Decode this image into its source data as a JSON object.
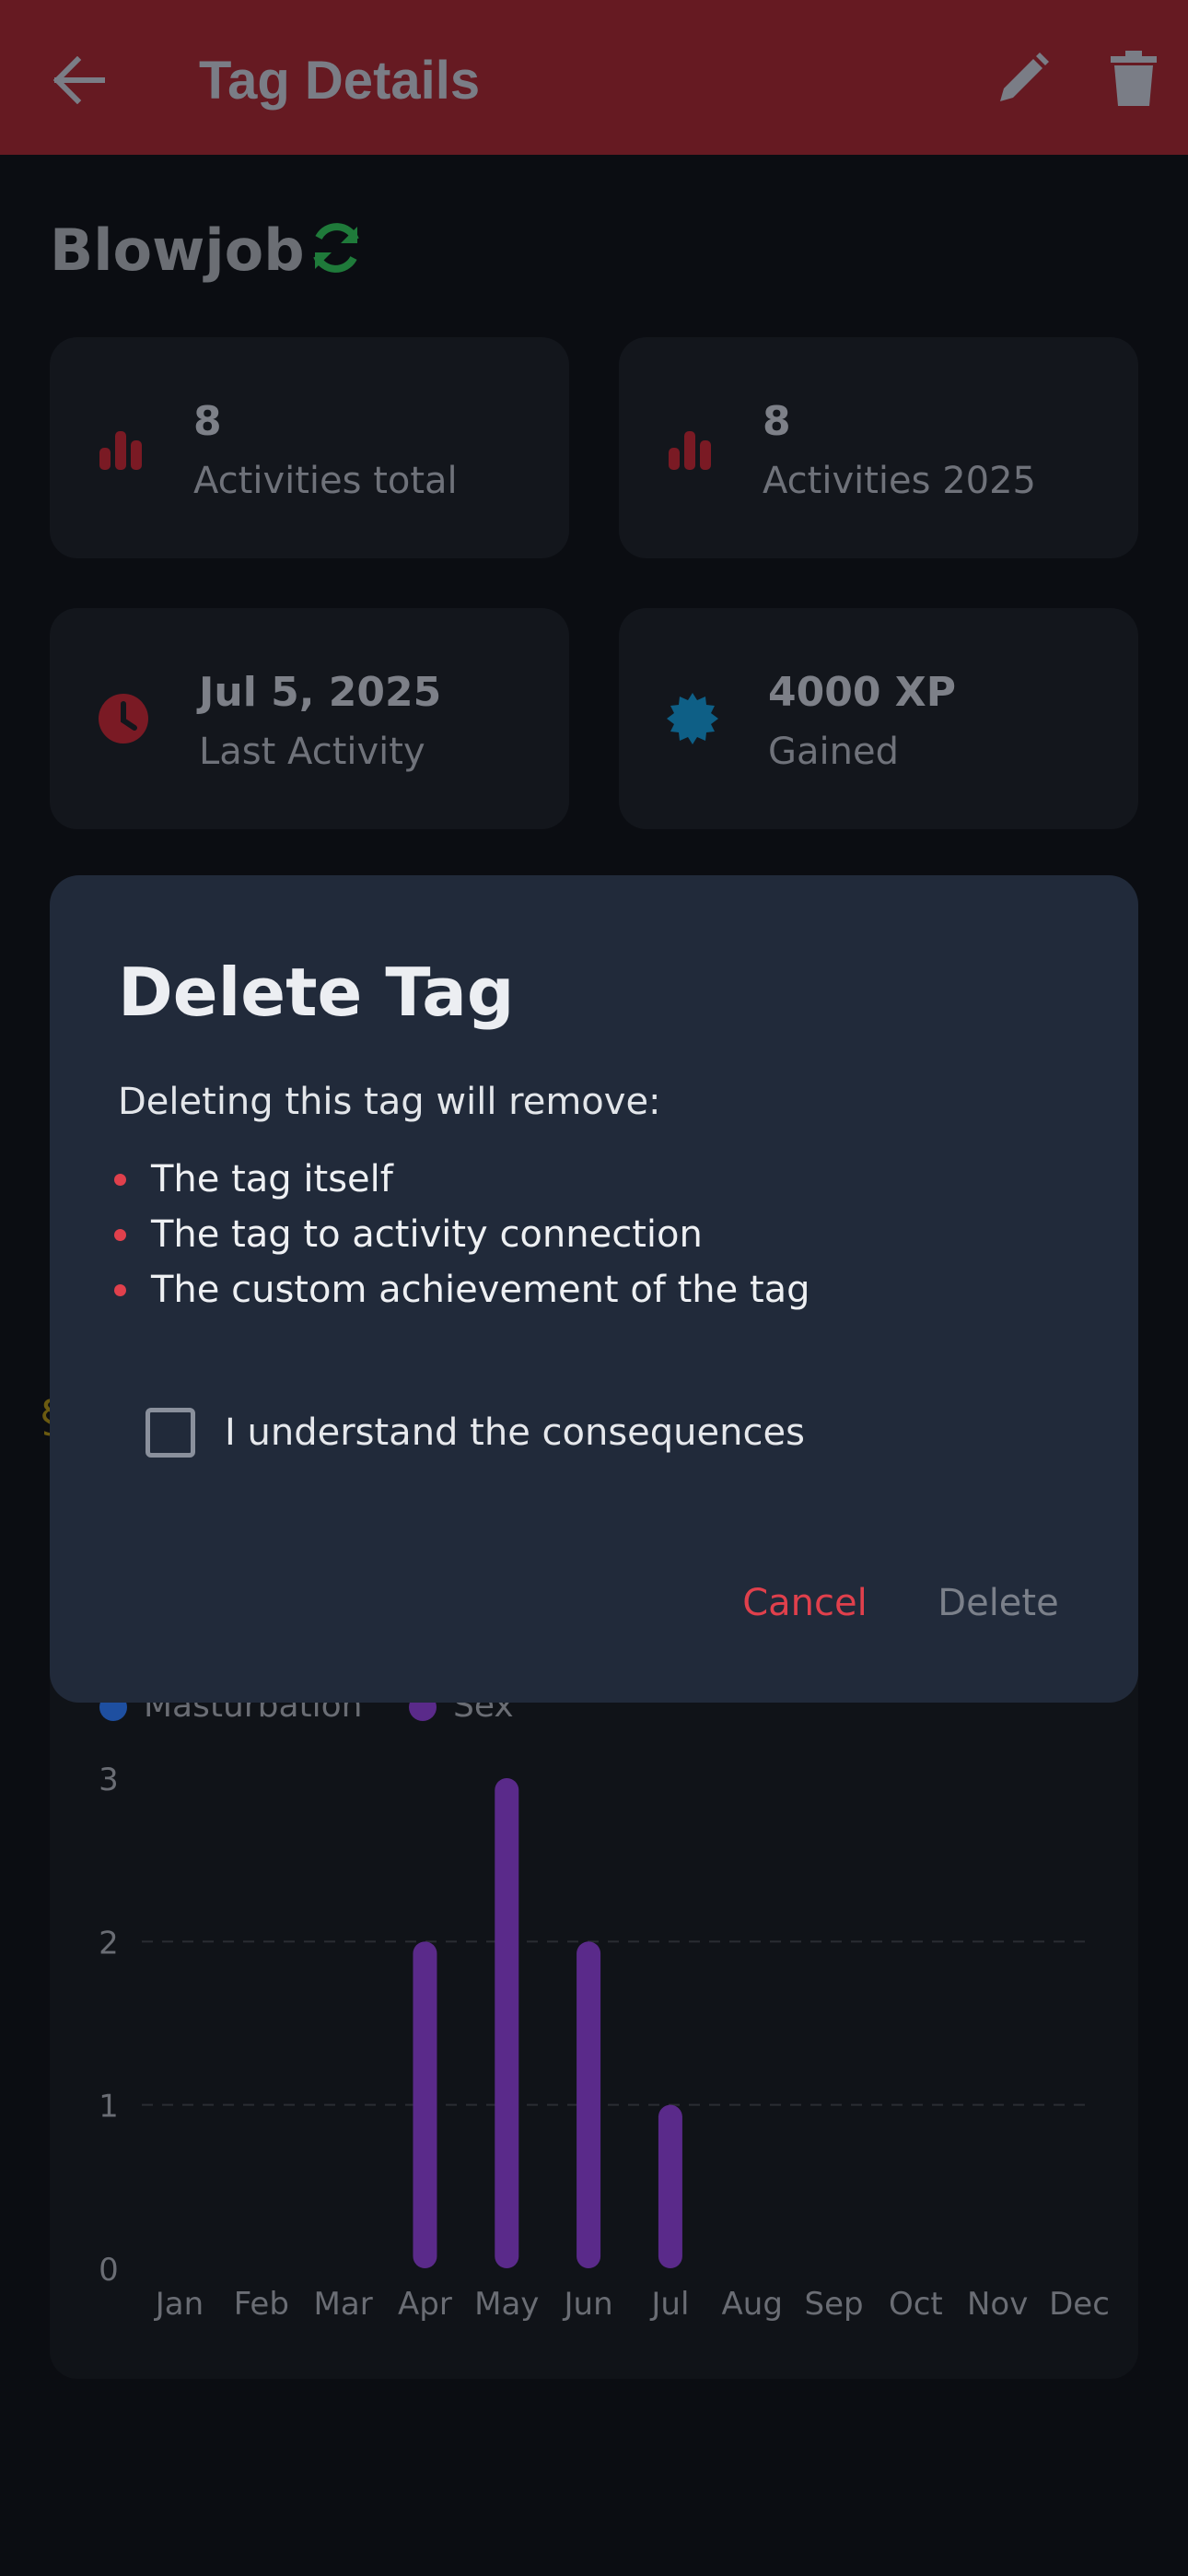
{
  "app_bar": {
    "title": "Tag Details"
  },
  "tag": {
    "name": "Blowjob"
  },
  "stats": [
    {
      "value": "8",
      "label": "Activities total",
      "icon": "bar-chart-icon"
    },
    {
      "value": "8",
      "label": "Activities 2025",
      "icon": "bar-chart-icon"
    },
    {
      "value": "Jul 5, 2025",
      "label": "Last Activity",
      "icon": "clock-icon"
    },
    {
      "value": "4000 XP",
      "label": "Gained",
      "icon": "badge-icon"
    }
  ],
  "colors": {
    "app_bar": "#661a22",
    "accent_red": "#e0404c",
    "sync_green": "#1f7a3a",
    "xp_blue": "#0e5f86",
    "masturbation_blue": "#1e4fa0",
    "sex_purple": "#5a2a8a"
  },
  "dialog": {
    "title": "Delete Tag",
    "intro": "Deleting this tag will remove:",
    "items": [
      "The tag itself",
      "The tag to activity connection",
      "The custom achievement of the tag"
    ],
    "checkbox_label": "I understand the consequences",
    "checkbox_checked": false,
    "cancel_label": "Cancel",
    "delete_label": "Delete"
  },
  "chart_data": {
    "type": "bar",
    "categories": [
      "Jan",
      "Feb",
      "Mar",
      "Apr",
      "May",
      "Jun",
      "Jul",
      "Aug",
      "Sep",
      "Oct",
      "Nov",
      "Dec"
    ],
    "series": [
      {
        "name": "Masturbation",
        "values": [
          0,
          0,
          0,
          0,
          0,
          0,
          0,
          0,
          0,
          0,
          0,
          0
        ]
      },
      {
        "name": "Sex",
        "values": [
          0,
          0,
          0,
          2,
          3,
          2,
          1,
          0,
          0,
          0,
          0,
          0
        ]
      }
    ],
    "y_ticks": [
      "0",
      "1",
      "2",
      "3"
    ],
    "ylim": [
      0,
      3
    ],
    "grid": true,
    "legend_placement": "top-left"
  }
}
